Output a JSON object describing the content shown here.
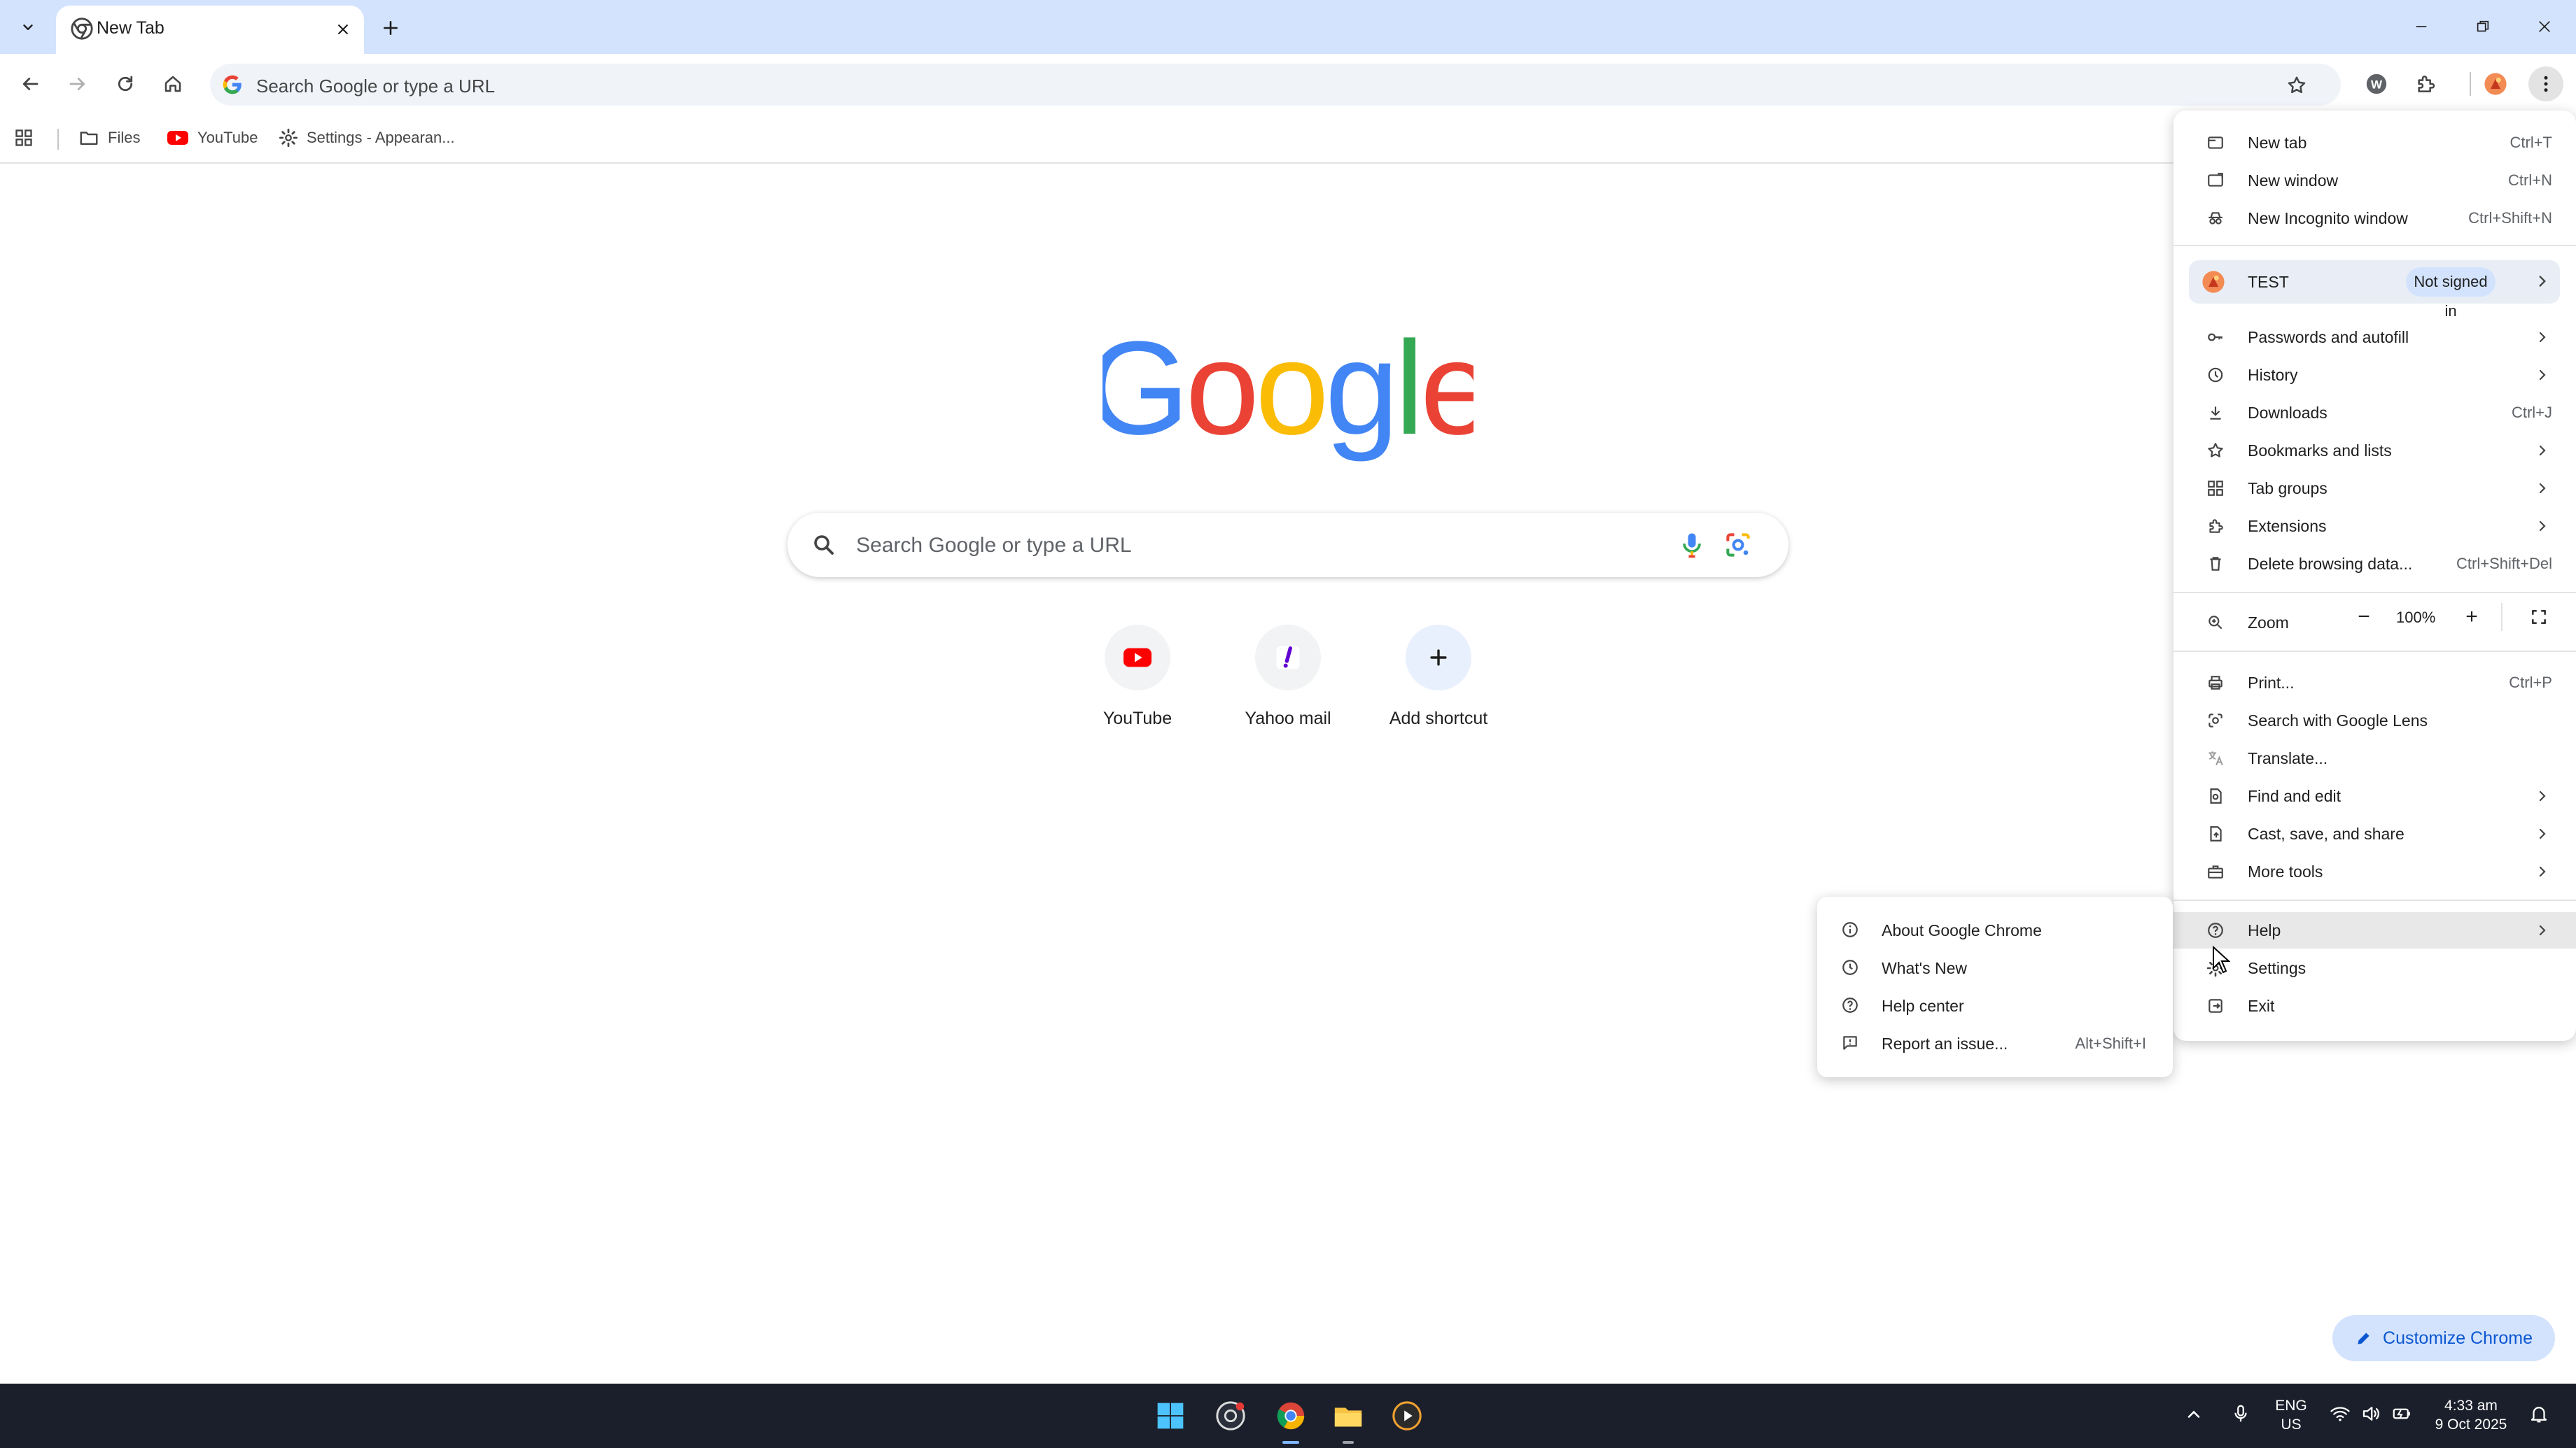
{
  "window": {
    "tab_title": "New Tab"
  },
  "toolbar": {
    "omnibox_placeholder": "Search Google or type a URL"
  },
  "bookmarks": [
    {
      "label": "Files"
    },
    {
      "label": "YouTube"
    },
    {
      "label": "Settings - Appearan..."
    }
  ],
  "ntp": {
    "logo_letters": [
      {
        "ch": "G",
        "color": "#4285F4"
      },
      {
        "ch": "o",
        "color": "#EA4335"
      },
      {
        "ch": "o",
        "color": "#FBBC05"
      },
      {
        "ch": "g",
        "color": "#4285F4"
      },
      {
        "ch": "l",
        "color": "#34A853"
      },
      {
        "ch": "e",
        "color": "#EA4335"
      }
    ],
    "search_placeholder": "Search Google or type a URL",
    "shortcuts": [
      {
        "label": "YouTube",
        "icon": "youtube-icon"
      },
      {
        "label": "Yahoo mail",
        "icon": "yahoo-mail-icon"
      },
      {
        "label": "Add shortcut",
        "icon": "plus-icon"
      }
    ],
    "customize_label": "Customize Chrome"
  },
  "menu": {
    "new_tab": {
      "label": "New tab",
      "shortcut": "Ctrl+T"
    },
    "new_window": {
      "label": "New window",
      "shortcut": "Ctrl+N"
    },
    "new_incognito": {
      "label": "New Incognito window",
      "shortcut": "Ctrl+Shift+N"
    },
    "profile": {
      "name": "TEST",
      "status": "Not signed in"
    },
    "passwords": {
      "label": "Passwords and autofill"
    },
    "history": {
      "label": "History"
    },
    "downloads": {
      "label": "Downloads",
      "shortcut": "Ctrl+J"
    },
    "bookmarks": {
      "label": "Bookmarks and lists"
    },
    "tab_groups": {
      "label": "Tab groups"
    },
    "extensions": {
      "label": "Extensions"
    },
    "delete_data": {
      "label": "Delete browsing data...",
      "shortcut": "Ctrl+Shift+Del"
    },
    "zoom": {
      "label": "Zoom",
      "value": "100%",
      "minus": "−",
      "plus": "+"
    },
    "print": {
      "label": "Print...",
      "shortcut": "Ctrl+P"
    },
    "lens": {
      "label": "Search with Google Lens"
    },
    "translate": {
      "label": "Translate..."
    },
    "find_edit": {
      "label": "Find and edit"
    },
    "cast": {
      "label": "Cast, save, and share"
    },
    "more_tools": {
      "label": "More tools"
    },
    "help": {
      "label": "Help"
    },
    "settings": {
      "label": "Settings"
    },
    "exit": {
      "label": "Exit"
    }
  },
  "help_submenu": {
    "about": {
      "label": "About Google Chrome"
    },
    "whats_new": {
      "label": "What's New"
    },
    "help_center": {
      "label": "Help center"
    },
    "report": {
      "label": "Report an issue...",
      "shortcut": "Alt+Shift+I"
    }
  },
  "taskbar": {
    "lang_top": "ENG",
    "lang_bottom": "US",
    "time": "4:33 am",
    "date": "9 Oct 2025"
  },
  "colors": {
    "accent": "#0b57d0",
    "tabstrip": "#d3e3fd",
    "taskbar": "#1b1f2b"
  }
}
